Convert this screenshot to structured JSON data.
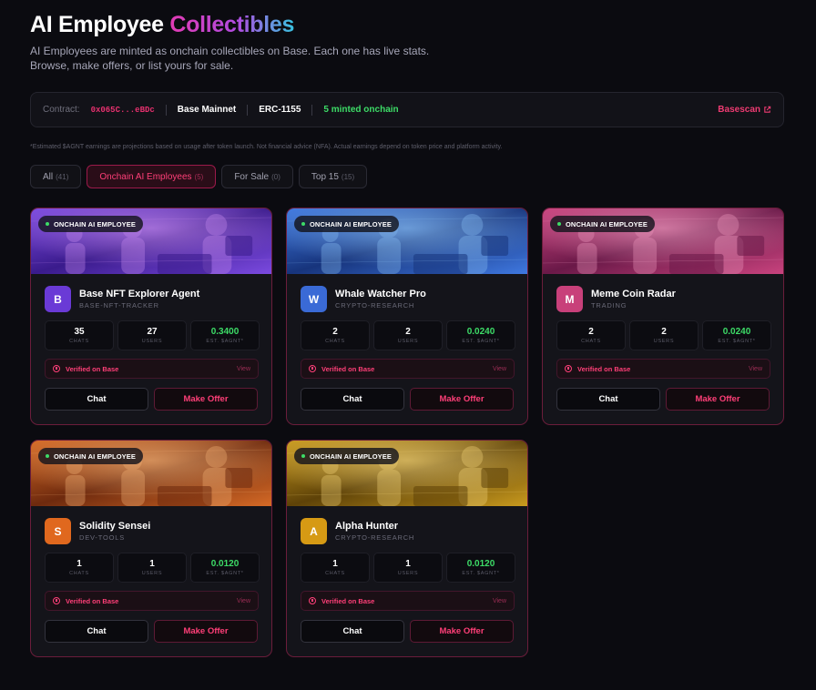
{
  "header": {
    "title_part1": "AI Employee",
    "title_part2": "Collectibles",
    "subtitle_line1": "AI Employees are minted as onchain collectibles on Base. Each one has live stats.",
    "subtitle_line2": "Browse, make offers, or list yours for sale."
  },
  "contract": {
    "label": "Contract:",
    "address": "0x065C...eBDc",
    "network": "Base Mainnet",
    "standard": "ERC-1155",
    "minted": "5 minted onchain",
    "explorer_label": "Basescan"
  },
  "disclaimer": "*Estimated $AGNT earnings are projections based on usage after token launch. Not financial advice (NFA). Actual earnings depend on token price and platform activity.",
  "tabs": [
    {
      "label": "All",
      "count": "(41)"
    },
    {
      "label": "Onchain AI Employees",
      "count": "(5)"
    },
    {
      "label": "For Sale",
      "count": "(0)"
    },
    {
      "label": "Top 15",
      "count": "(15)"
    }
  ],
  "card_common": {
    "badge": "ONCHAIN AI EMPLOYEE",
    "chats_label": "CHATS",
    "users_label": "USERS",
    "earn_label": "EST. $AGNT*",
    "verified": "Verified on Base",
    "view": "View",
    "chat_button": "Chat",
    "offer_button": "Make Offer"
  },
  "cards": [
    {
      "initial": "B",
      "name": "Base NFT Explorer Agent",
      "tag": "BASE-NFT-TRACKER",
      "chats": "35",
      "users": "27",
      "earn": "0.3400",
      "theme": "purple",
      "avatar_color": "#6a3ad6"
    },
    {
      "initial": "W",
      "name": "Whale Watcher Pro",
      "tag": "CRYPTO-RESEARCH",
      "chats": "2",
      "users": "2",
      "earn": "0.0240",
      "theme": "blue",
      "avatar_color": "#3a6ad6"
    },
    {
      "initial": "M",
      "name": "Meme Coin Radar",
      "tag": "TRADING",
      "chats": "2",
      "users": "2",
      "earn": "0.0240",
      "theme": "pink",
      "avatar_color": "#c8407a"
    },
    {
      "initial": "S",
      "name": "Solidity Sensei",
      "tag": "DEV-TOOLS",
      "chats": "1",
      "users": "1",
      "earn": "0.0120",
      "theme": "orange",
      "avatar_color": "#e0681e"
    },
    {
      "initial": "A",
      "name": "Alpha Hunter",
      "tag": "CRYPTO-RESEARCH",
      "chats": "1",
      "users": "1",
      "earn": "0.0120",
      "theme": "gold",
      "avatar_color": "#d69a14"
    }
  ],
  "colors": {
    "accent": "#ff3f78",
    "positive": "#3ddc67",
    "background": "#0b0b10"
  }
}
